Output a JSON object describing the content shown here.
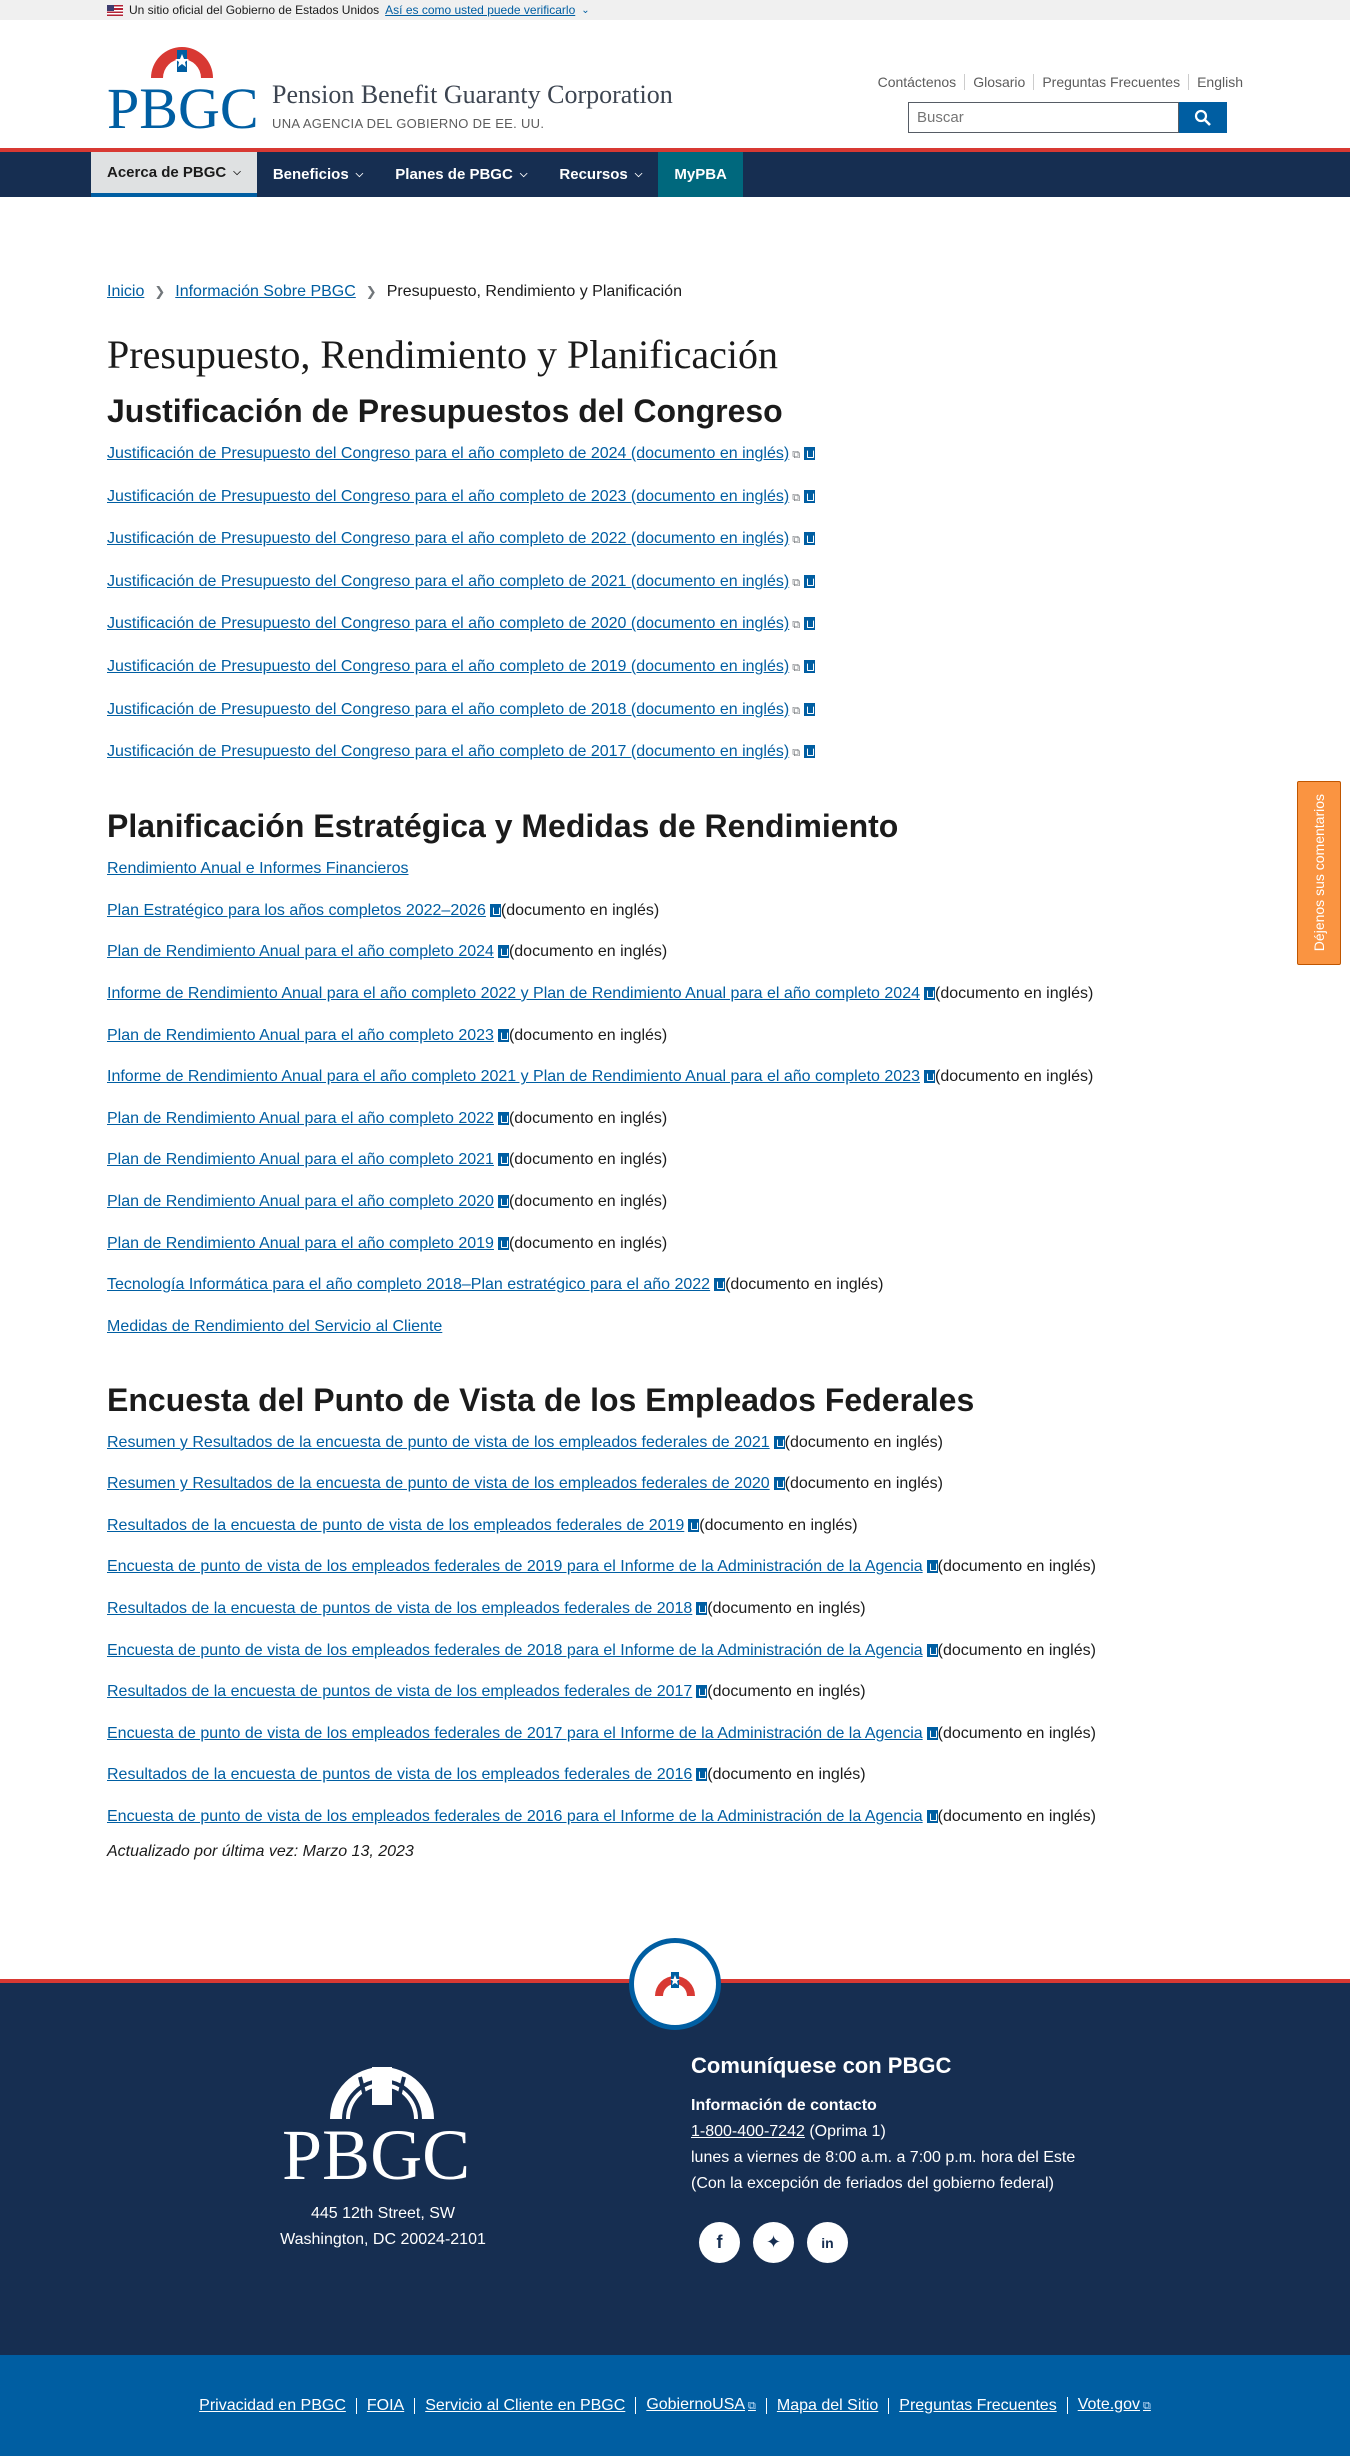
{
  "gov_banner": {
    "text": "Un sitio oficial del Gobierno de Estados Unidos",
    "verify_link": "Así es como usted puede verificarlo"
  },
  "header": {
    "logo_text": "PBGC",
    "org_name": "Pension Benefit Guaranty Corporation",
    "org_subtitle": "UNA AGENCIA DEL GOBIERNO DE EE. UU.",
    "util_links": [
      "Contáctenos",
      "Glosario",
      "Preguntas Frecuentes",
      "English"
    ],
    "search_placeholder": "Buscar"
  },
  "nav": {
    "items": [
      "Acerca de PBGC",
      "Beneficios",
      "Planes de PBGC",
      "Recursos"
    ],
    "mypba": "MyPBA"
  },
  "breadcrumb": [
    "Inicio",
    "Información Sobre PBGC",
    "Presupuesto, Rendimiento y Planificación"
  ],
  "page_title": "Presupuesto, Rendimiento y Planificación",
  "doc_suffix": "(documento en inglés)",
  "sections": [
    {
      "heading": "Justificación de Presupuestos del Congreso",
      "links": [
        "Justificación de Presupuesto del Congreso para el año completo de 2024 (documento en inglés)",
        "Justificación de Presupuesto del Congreso para el año completo de 2023 (documento en inglés)",
        "Justificación de Presupuesto del Congreso para el año completo de 2022 (documento en inglés)",
        "Justificación de Presupuesto del Congreso para el año completo de 2021 (documento en inglés)",
        "Justificación de Presupuesto del Congreso para el año completo de 2020 (documento en inglés)",
        "Justificación de Presupuesto del Congreso para el año completo de 2019 (documento en inglés)",
        "Justificación de Presupuesto del Congreso para el año completo de 2018 (documento en inglés)",
        "Justificación de Presupuesto del Congreso para el año completo de 2017 (documento en inglés)"
      ]
    },
    {
      "heading": "Planificación Estratégica y Medidas de Rendimiento",
      "links": [
        "Rendimiento Anual e Informes Financieros",
        "Plan Estratégico para los años completos 2022–2026",
        "Plan de Rendimiento Anual para el año completo 2024",
        "Informe de Rendimiento Anual para el año completo 2022 y Plan de Rendimiento Anual para el año completo 2024",
        "Plan de Rendimiento Anual para el año completo 2023",
        "Informe de Rendimiento Anual para el año completo 2021 y Plan de Rendimiento Anual para el año completo 2023",
        "Plan de Rendimiento Anual para el año completo 2022",
        "Plan de Rendimiento Anual para el año completo 2021",
        "Plan de Rendimiento Anual para el año completo 2020",
        "Plan de Rendimiento Anual para el año completo 2019",
        "Tecnología Informática para el año completo 2018–Plan estratégico para el año 2022",
        "Medidas de Rendimiento del Servicio al Cliente"
      ]
    },
    {
      "heading": "Encuesta del Punto de Vista de los Empleados Federales",
      "links": [
        "Resumen y Resultados de la encuesta de punto de vista de los empleados federales de 2021",
        "Resumen y Resultados de la encuesta de punto de vista de los empleados federales de 2020",
        "Resultados de la encuesta de punto de vista de los empleados federales de 2019",
        "Encuesta de punto de vista de los empleados federales de 2019 para el Informe de la Administración de la Agencia",
        "Resultados de la encuesta de puntos de vista de los empleados federales de 2018",
        "Encuesta de punto de vista de los empleados federales de 2018 para el Informe de la Administración de la Agencia",
        "Resultados de la encuesta de puntos de vista de los empleados federales de 2017",
        "Encuesta de punto de vista de los empleados federales de 2017 para el Informe de la Administración de la Agencia",
        "Resultados de la encuesta de puntos de vista de los empleados federales de 2016",
        "Encuesta de punto de vista de los empleados federales de 2016 para el Informe de la Administración de la Agencia"
      ]
    }
  ],
  "last_updated": "Actualizado por última vez: Marzo 13, 2023",
  "feedback_tab": "Déjenos sus comentarios",
  "footer": {
    "logo_text": "PBGC",
    "address_line1": "445 12th Street, SW",
    "address_line2": "Washington, DC 20024-2101",
    "contact_heading": "Comuníquese con PBGC",
    "contact_label": "Información de contacto",
    "phone": "1-800-400-7242",
    "phone_note": "(Oprima 1)",
    "hours": "lunes a viernes de 8:00 a.m. a 7:00 p.m. hora del Este",
    "holidays": "(Con la excepción de feriados del gobierno federal)",
    "social": [
      "facebook-icon",
      "twitter-icon",
      "linkedin-icon"
    ],
    "bottom_links": [
      "Privacidad en PBGC",
      "FOIA",
      "Servicio al Cliente en PBGC",
      "GobiernoUSA",
      "Mapa del Sitio",
      "Preguntas Frecuentes",
      "Vote.gov"
    ]
  },
  "colors": {
    "navy": "#162e51",
    "link_blue": "#005ea2",
    "accent_red": "#d83933",
    "feedback_orange": "#fa9441"
  }
}
